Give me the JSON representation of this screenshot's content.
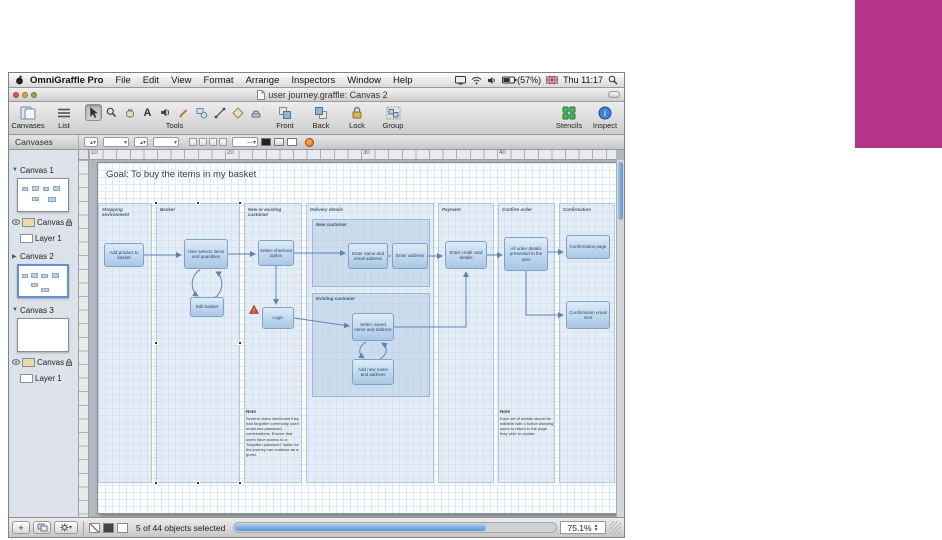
{
  "colors": {
    "magenta_block": "#b53389",
    "node_fill": "#c6dcf0",
    "selection_blue": "#5b93d6"
  },
  "menu_bar": {
    "app_name": "OmniGraffle Pro",
    "items": [
      "File",
      "Edit",
      "View",
      "Format",
      "Arrange",
      "Inspectors",
      "Window",
      "Help"
    ],
    "status": {
      "battery_percent": "(57%)",
      "clock": "Thu 11:17"
    }
  },
  "window": {
    "title": "user journey.graffle: Canvas 2"
  },
  "toolbar": {
    "canvases": "Canvases",
    "list": "List",
    "tools": "Tools",
    "front": "Front",
    "back": "Back",
    "lock": "Lock",
    "group": "Group",
    "stencils": "Stencils",
    "inspect": "Inspect"
  },
  "sidebar": {
    "header": "Canvases",
    "canvas1": "Canvas 1",
    "canvas2": "Canvas 2",
    "canvas3": "Canvas 3",
    "layer_canvas": "Canvas",
    "layer1": "Layer 1"
  },
  "ruler": {
    "labels": [
      "10",
      "20",
      "30",
      "40"
    ]
  },
  "canvas": {
    "goal": "Goal: To buy the items in my basket",
    "lanes": [
      "Shopping environment",
      "Basket",
      "New or existing customer",
      "Delivery details",
      "Payment",
      "Confirm order",
      "Confirmation"
    ],
    "groups": [
      "New customer",
      "Existing customer"
    ],
    "nodes": [
      "Add product to basket",
      "User selects items and quantities",
      "Edit basket",
      "Select checkout option",
      "Login",
      "Enter name and email address",
      "Enter address",
      "Select saved name and address",
      "Add new name and address",
      "Enter credit card details",
      "All order details presented to the user",
      "Confirmation page",
      "Confirmation email sent"
    ],
    "notes": [
      {
        "title": "Note",
        "body": "Several users mentioned they had forgotten commonly used email and password combinations. Ensure that users have access to a 'forgotten password' option so the journey can continue as a guest."
      },
      {
        "title": "Note",
        "body": "Each set of details should be editable with a button allowing users to return to the page they wish to update."
      }
    ]
  },
  "status_bar": {
    "selection": "5 of 44 objects selected",
    "zoom": "75.1%"
  }
}
